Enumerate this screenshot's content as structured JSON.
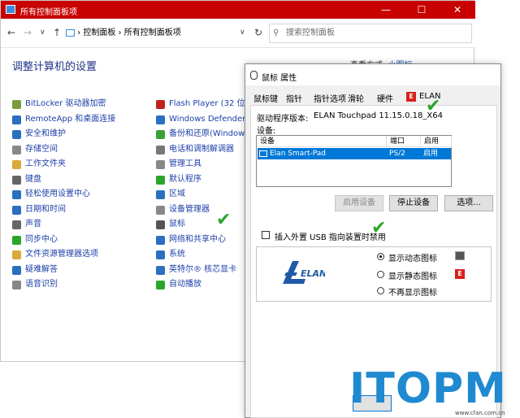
{
  "control_panel": {
    "title": "所有控制面板项",
    "breadcrumb": [
      "控制面板",
      "所有控制面板项"
    ],
    "search_placeholder": "搜索控制面板",
    "heading": "调整计算机的设置",
    "view_by_label": "查看方式:",
    "view_by_value": "小图标",
    "left_items": [
      "BitLocker 驱动器加密",
      "RemoteApp 和桌面连接",
      "安全和维护",
      "存储空间",
      "工作文件夹",
      "键盘",
      "轻松使用设置中心",
      "日期和时间",
      "声音",
      "同步中心",
      "文件资源管理器选项",
      "疑难解答",
      "语音识别"
    ],
    "right_items": [
      "Flash Player (32 位)",
      "Windows Defender 防",
      "备份和还原(Windows 7",
      "电话和调制解调器",
      "管理工具",
      "默认程序",
      "区域",
      "设备管理器",
      "鼠标",
      "网络和共享中心",
      "系统",
      "英特尔® 核芯显卡",
      "自动播放"
    ],
    "left_icon_colors": [
      "#7a9c3a",
      "#2a6fc0",
      "#2a6fc0",
      "#888888",
      "#d9a93a",
      "#666666",
      "#2a6fc0",
      "#2a6fc0",
      "#666666",
      "#2aa52a",
      "#d9a93a",
      "#2a6fc0",
      "#888888"
    ],
    "right_icon_colors": [
      "#c02020",
      "#2a6fc0",
      "#3aa03a",
      "#777777",
      "#888888",
      "#2aa52a",
      "#2a6fc0",
      "#888888",
      "#555555",
      "#2a6fc0",
      "#2a6fc0",
      "#2a6fc0",
      "#2aa52a"
    ]
  },
  "mouse_dialog": {
    "title": "鼠标 属性",
    "tabs": [
      "鼠标键",
      "指针",
      "指针选项",
      "滑轮",
      "硬件",
      "ELAN"
    ],
    "driver_label": "驱动程序版本:",
    "driver_value": "ELAN Touchpad 11.15.0.18_X64",
    "devices_label": "设备:",
    "columns": [
      "设备",
      "端口",
      "启用"
    ],
    "row": {
      "device": "Elan Smart-Pad",
      "port": "PS/2",
      "enabled": "启用"
    },
    "btn_enable": "启用设备",
    "btn_stop": "停止设备",
    "btn_options": "选项...",
    "checkbox_label": "插入外置 USB 指向装置时禁用",
    "radio_options": [
      "显示动态图标",
      "显示静态图标",
      "不再显示图标"
    ],
    "selected_radio": 0,
    "logo_text": "ELAN"
  },
  "watermark": {
    "text": "ITOPM",
    "small": "www.cfan.com.cn"
  }
}
